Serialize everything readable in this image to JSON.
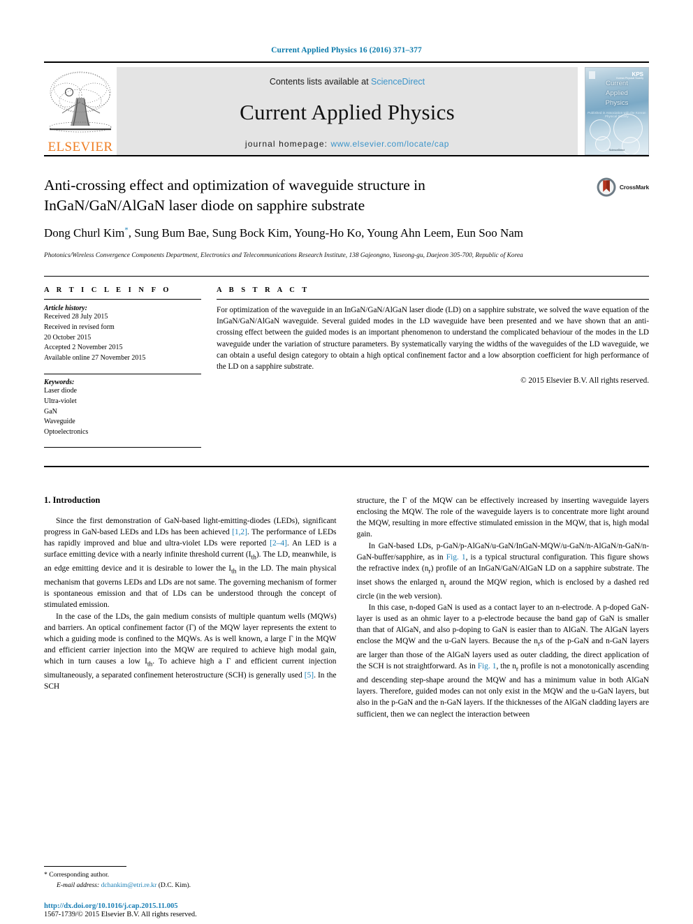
{
  "running_head": "Current Applied Physics 16 (2016) 371–377",
  "masthead": {
    "publisher_word": "ELSEVIER",
    "contents_prefix": "Contents lists available at",
    "contents_link": "ScienceDirect",
    "journal_name": "Current Applied Physics",
    "homepage_label": "journal homepage:",
    "homepage_link": "www.elsevier.com/locate/cap",
    "cover": {
      "title_line1": "Current",
      "title_line2": "Applied",
      "title_line3": "Physics",
      "subtitle": "Published in Association with the Korean Physical Society",
      "badge": "KPS",
      "badge_sub": "Korean Physical Society",
      "footer": "ScienceDirect"
    }
  },
  "article": {
    "title": "Anti-crossing effect and optimization of waveguide structure in InGaN/GaN/AlGaN laser diode on sapphire substrate",
    "authors": "Dong Churl Kim",
    "authors_rest": ", Sung Bum Bae, Sung Bock Kim, Young-Ho Ko, Young Ahn Leem, Eun Soo Nam",
    "corresponding_marker": "*",
    "affiliation": "Photonics/Wireless Convergence Components Department, Electronics and Telecommunications Research Institute, 138 Gajeongno, Yuseong-gu, Daejeon 305-700, Republic of Korea",
    "crossmark_label": "CrossMark"
  },
  "info": {
    "heading": "A R T I C L E  I N F O",
    "history_label": "Article history:",
    "history": [
      "Received 28 July 2015",
      "Received in revised form",
      "20 October 2015",
      "Accepted 2 November 2015",
      "Available online 27 November 2015"
    ],
    "keywords_label": "Keywords:",
    "keywords": [
      "Laser diode",
      "Ultra-violet",
      "GaN",
      "Waveguide",
      "Optoelectronics"
    ]
  },
  "abstract": {
    "heading": "A B S T R A C T",
    "text": "For optimization of the waveguide in an InGaN/GaN/AlGaN laser diode (LD) on a sapphire substrate, we solved the wave equation of the InGaN/GaN/AlGaN waveguide. Several guided modes in the LD waveguide have been presented and we have shown that an anti-crossing effect between the guided modes is an important phenomenon to understand the complicated behaviour of the modes in the LD waveguide under the variation of structure parameters. By systematically varying the widths of the waveguides of the LD waveguide, we can obtain a useful design category to obtain a high optical confinement factor and a low absorption coefficient for high performance of the LD on a sapphire substrate.",
    "copyright": "© 2015 Elsevier B.V. All rights reserved."
  },
  "body": {
    "section_heading": "1. Introduction",
    "left_p1_a": "Since the first demonstration of GaN-based light-emitting-diodes (LEDs), significant progress in GaN-based LEDs and LDs has been achieved ",
    "left_p1_cite1": "[1,2]",
    "left_p1_b": ". The performance of LEDs has rapidly improved and blue and ultra-violet LDs were reported ",
    "left_p1_cite2": "[2–4]",
    "left_p1_c": ". An LED is a surface emitting device with a nearly infinite threshold current (I",
    "left_p1_sub1": "th",
    "left_p1_d": "). The LD, meanwhile, is an edge emitting device and it is desirable to lower the I",
    "left_p1_sub2": "th",
    "left_p1_e": " in the LD. The main physical mechanism that governs LEDs and LDs are not same. The governing mechanism of former is spontaneous emission and that of LDs can be understood through the concept of stimulated emission.",
    "left_p2_a": "In the case of the LDs, the gain medium consists of multiple quantum wells (MQWs) and barriers. An optical confinement factor (Γ) of the MQW layer represents the extent to which a guiding mode is confined to the MQWs. As is well known, a large Γ in the MQW and efficient carrier injection into the MQW are required to achieve high modal gain, which in turn causes a low I",
    "left_p2_sub1": "th",
    "left_p2_b": ". To achieve high a Γ and efficient current injection simultaneously, a separated confinement heterostructure (SCH) is generally used ",
    "left_p2_cite": "[5]",
    "left_p2_c": ". In the SCH",
    "right_p1": "structure, the Γ of the MQW can be effectively increased by inserting waveguide layers enclosing the MQW. The role of the waveguide layers is to concentrate more light around the MQW, resulting in more effective stimulated emission in the MQW, that is, high modal gain.",
    "right_p2_a": "In GaN-based LDs, p-GaN/p-AlGaN/u-GaN/InGaN-MQW/u-GaN/n-AlGaN/n-GaN/n-GaN-buffer/sapphire, as in ",
    "right_p2_fig": "Fig. 1",
    "right_p2_b": ", is a typical structural configuration. This figure shows the refractive index (n",
    "right_p2_sub1": "r",
    "right_p2_c": ") profile of an InGaN/GaN/AlGaN LD on a sapphire substrate. The inset shows the enlarged n",
    "right_p2_sub2": "r",
    "right_p2_d": " around the MQW region, which is enclosed by a dashed red circle (in the web version).",
    "right_p3_a": "In this case, n-doped GaN is used as a contact layer to an n-electrode. A p-doped GaN-layer is used as an ohmic layer to a p-electrode because the band gap of GaN is smaller than that of AlGaN, and also p-doping to GaN is easier than to AlGaN. The AlGaN layers enclose the MQW and the u-GaN layers. Because the n",
    "right_p3_sub1": "r",
    "right_p3_b": "s of the p-GaN and n-GaN layers are larger than those of the AlGaN layers used as outer cladding, the direct application of the SCH is not straightforward. As in ",
    "right_p3_fig": "Fig. 1",
    "right_p3_c": ", the n",
    "right_p3_sub2": "r",
    "right_p3_d": " profile is not a monotonically ascending and descending step-shape around the MQW and has a minimum value in both AlGaN layers. Therefore, guided modes can not only exist in the MQW and the u-GaN layers, but also in the p-GaN and the n-GaN layers. If the thicknesses of the AlGaN cladding layers are sufficient, then we can neglect the interaction between"
  },
  "footer": {
    "corresponding_marker": "*",
    "corresponding_label": "Corresponding author.",
    "email_label": "E-mail address:",
    "email": "dchankim@etri.re.kr",
    "email_suffix": "(D.C. Kim).",
    "doi": "http://dx.doi.org/10.1016/j.cap.2015.11.005",
    "issn_line": "1567-1739/© 2015 Elsevier B.V. All rights reserved."
  },
  "colors": {
    "link_blue": "#1b7fb5",
    "sciencedirect_blue": "#3c94c9",
    "elsevier_orange": "#ef7d22",
    "banner_gray": "#e4e4e4"
  }
}
